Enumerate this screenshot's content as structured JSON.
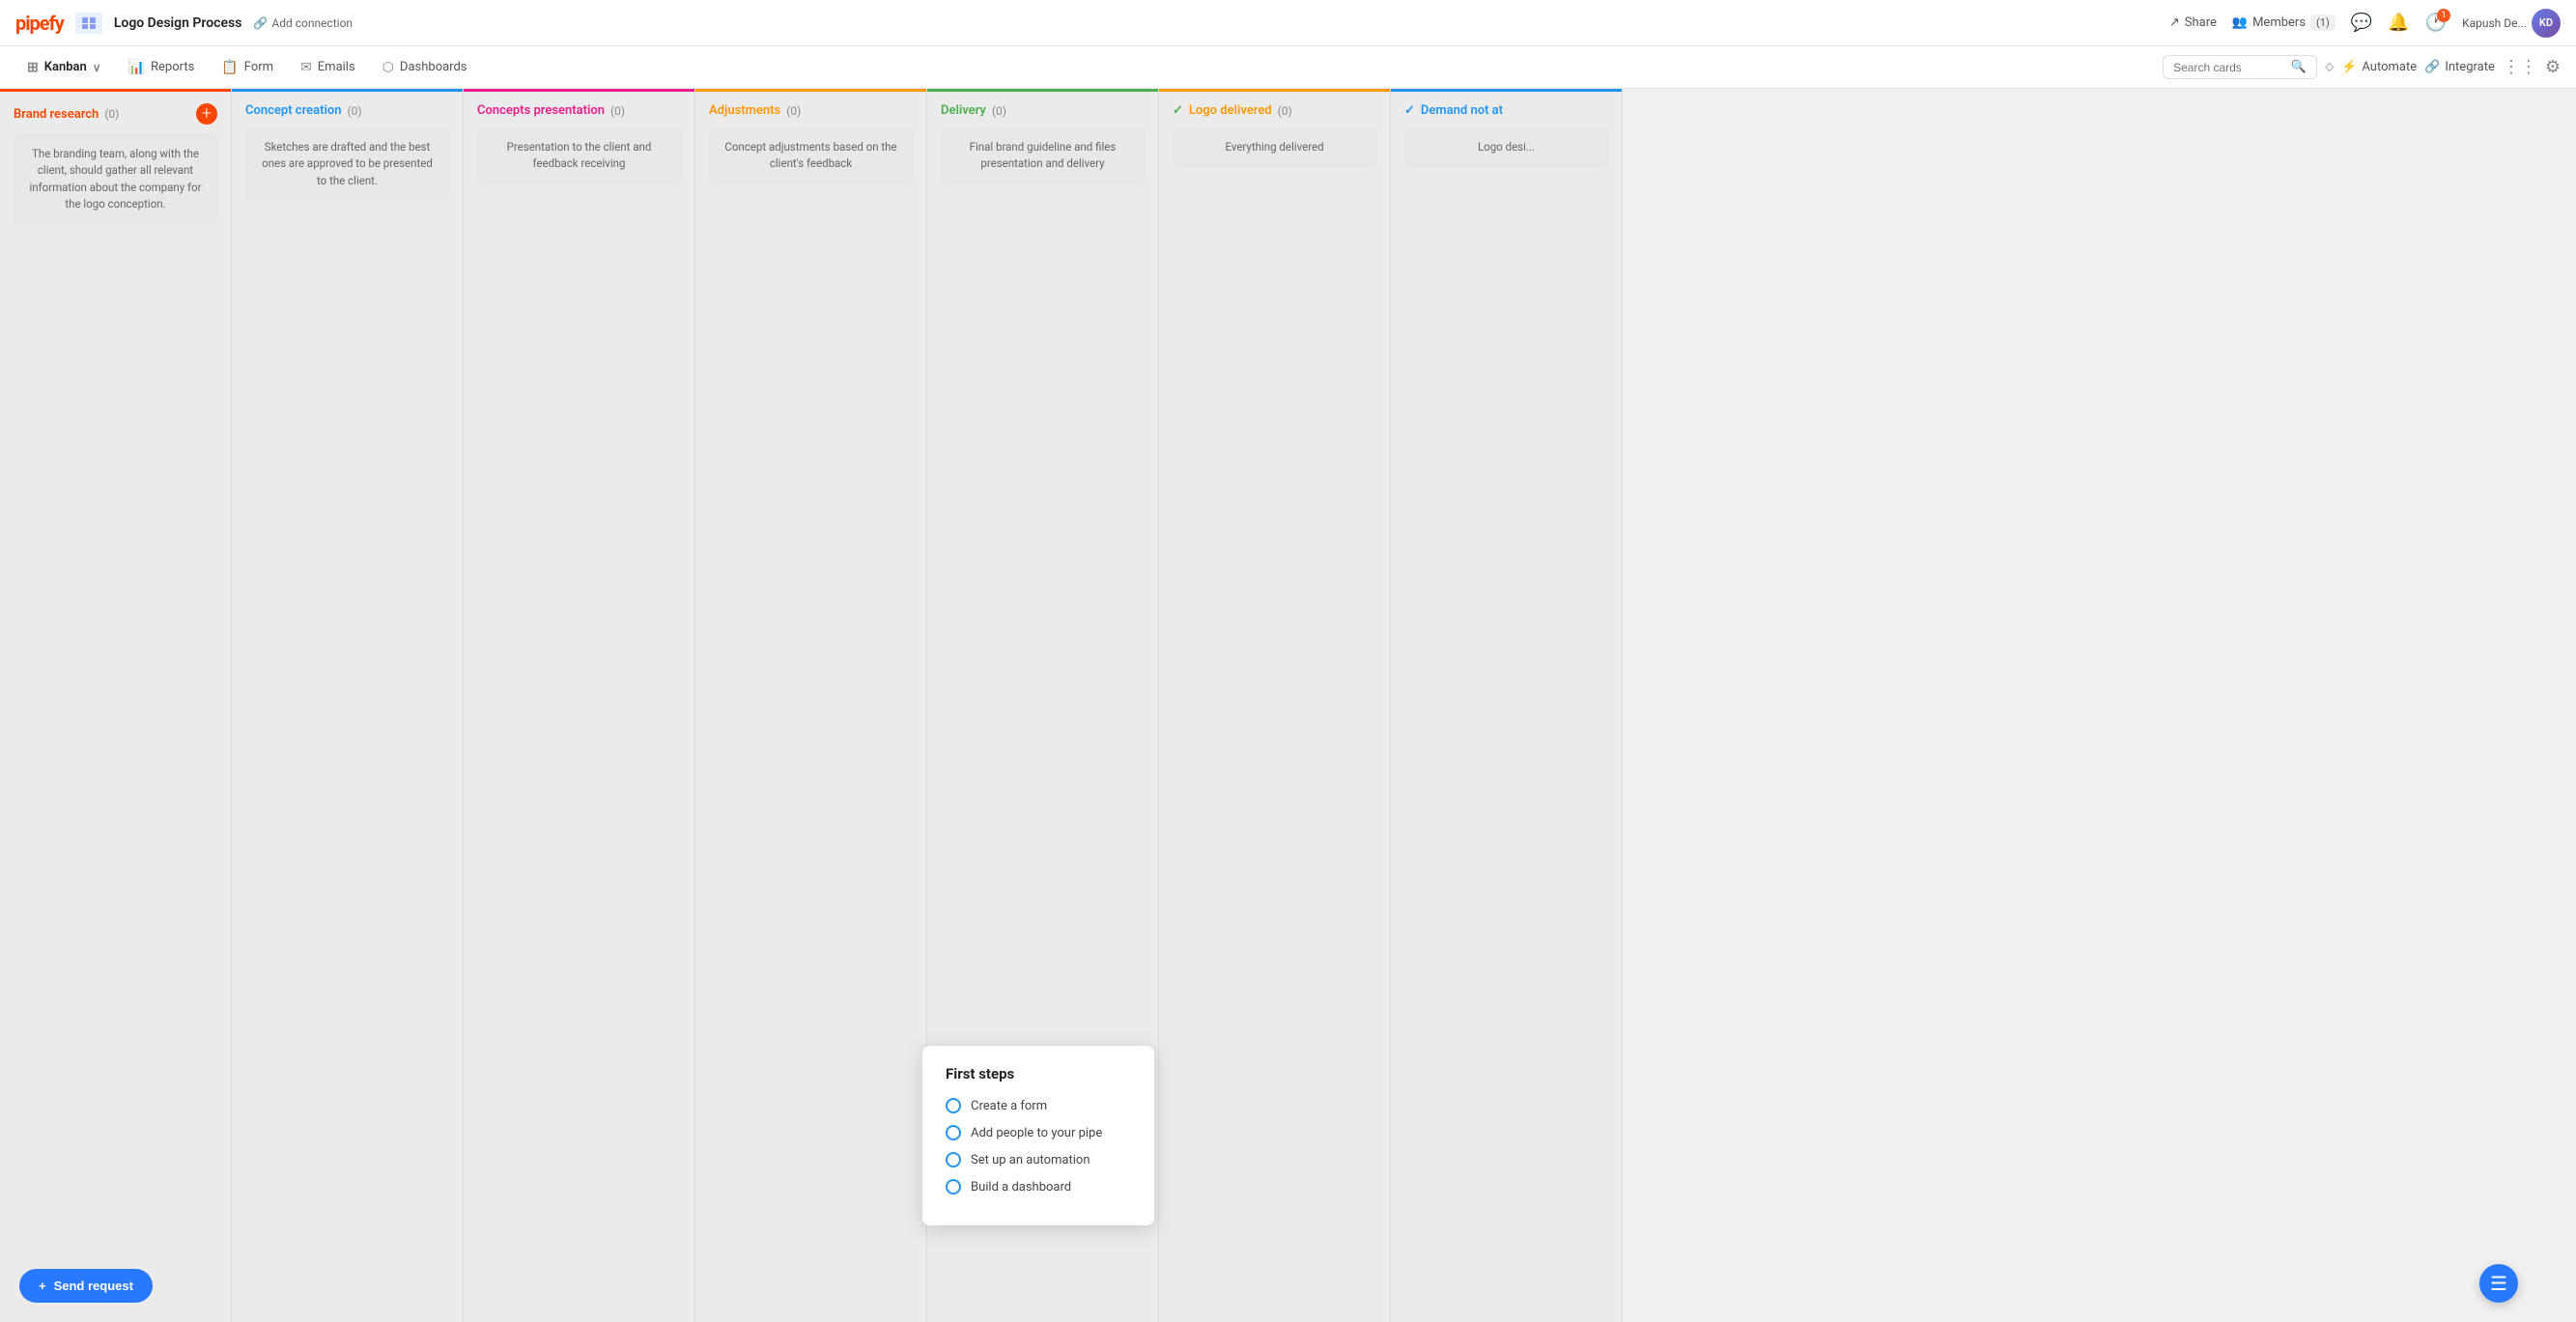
{
  "app": {
    "logo": "pipefy",
    "pipe_icon": "📋",
    "pipe_name": "Logo Design Process",
    "add_connection": "Add connection"
  },
  "top_nav_right": {
    "share": "Share",
    "members": "Members",
    "members_count": "(1)",
    "user_name": "Kapush De...",
    "notification_count": "1"
  },
  "second_nav": {
    "tabs": [
      {
        "id": "kanban",
        "label": "Kanban",
        "icon": "⊞",
        "active": true
      },
      {
        "id": "reports",
        "label": "Reports",
        "icon": "📊"
      },
      {
        "id": "form",
        "label": "Form",
        "icon": "📋"
      },
      {
        "id": "emails",
        "label": "Emails",
        "icon": "✉"
      },
      {
        "id": "dashboards",
        "label": "Dashboards",
        "icon": "⬡"
      }
    ],
    "search_placeholder": "Search cards",
    "automate": "Automate",
    "integrate": "Integrate"
  },
  "columns": [
    {
      "id": "brand-research",
      "title": "Brand research",
      "count": "(0)",
      "color_class": "col-brand-research",
      "title_class": "title-brand-research",
      "description": "The branding team, along with the client, should gather all relevant information about the company for the logo conception.",
      "has_add_circle": true,
      "prefix": null
    },
    {
      "id": "concept-creation",
      "title": "Concept creation",
      "count": "(0)",
      "color_class": "col-concept-creation",
      "title_class": "title-concept-creation",
      "description": "Sketches are drafted and the best ones are approved to be presented to the client.",
      "has_add_circle": false,
      "prefix": null
    },
    {
      "id": "concepts-presentation",
      "title": "Concepts presentation",
      "count": "(0)",
      "color_class": "col-concepts-presentation",
      "title_class": "title-concepts-presentation",
      "description": "Presentation to the client and feedback receiving",
      "has_add_circle": false,
      "prefix": null
    },
    {
      "id": "adjustments",
      "title": "Adjustments",
      "count": "(0)",
      "color_class": "col-adjustments",
      "title_class": "title-adjustments",
      "description": "Concept adjustments based on the client's feedback",
      "has_add_circle": false,
      "prefix": null
    },
    {
      "id": "delivery",
      "title": "Delivery",
      "count": "(0)",
      "color_class": "col-delivery",
      "title_class": "title-delivery",
      "description": "Final brand guideline and files presentation and delivery",
      "has_add_circle": false,
      "prefix": null
    },
    {
      "id": "logo-delivered",
      "title": "Logo delivered",
      "count": "(0)",
      "color_class": "col-logo-delivered",
      "title_class": "title-logo-delivered",
      "description": "Everything delivered",
      "has_add_circle": false,
      "prefix": "check-green"
    },
    {
      "id": "demand-not-at",
      "title": "Demand not at",
      "count": "",
      "color_class": "col-demand-not-at",
      "title_class": "title-demand-not-at",
      "description": "Logo desi...",
      "has_add_circle": false,
      "prefix": "check-blue"
    }
  ],
  "first_steps": {
    "title": "First steps",
    "items": [
      "Create a form",
      "Add people to your pipe",
      "Set up an automation",
      "Build a dashboard"
    ]
  },
  "send_request": {
    "label": "Send request",
    "plus": "+"
  },
  "fab": {
    "icon": "☰"
  }
}
